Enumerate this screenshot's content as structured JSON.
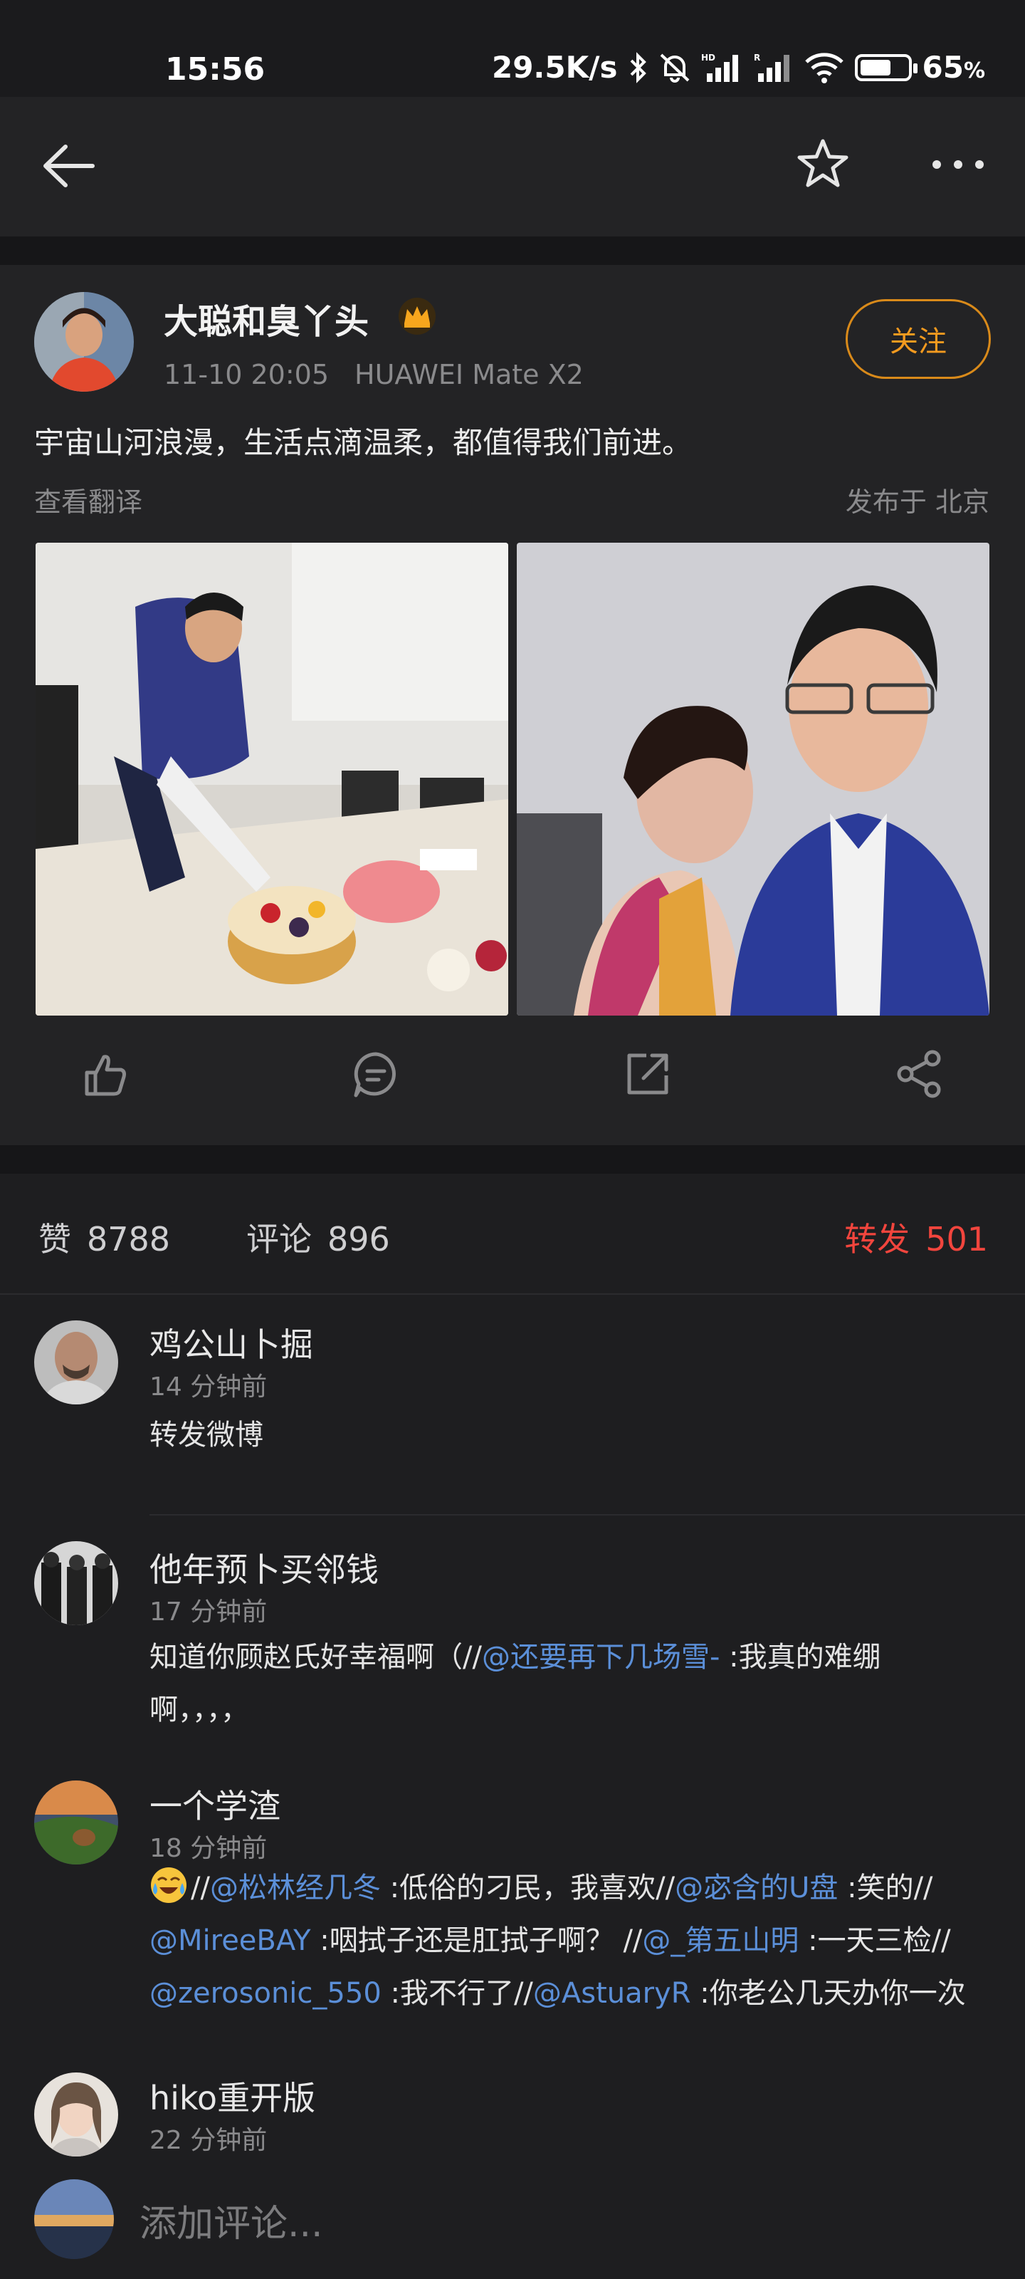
{
  "status": {
    "time": "15:56",
    "speed": "29.5K/s",
    "battery_pct": "65",
    "battery_level": 0.65,
    "icons": [
      "bluetooth-icon",
      "mute-icon",
      "signal-hd-icon",
      "signal-r-icon",
      "wifi-icon",
      "battery-icon"
    ]
  },
  "nav": {
    "icons": [
      "back-arrow-icon",
      "star-icon",
      "more-icon"
    ]
  },
  "post": {
    "author": "大聪和臭丫头",
    "date": "11-10 20:05",
    "device": "HUAWEI Mate X2",
    "follow_label": "关注",
    "text": "宇宙山河浪漫，生活点滴温柔，都值得我们前进。",
    "translate_label": "查看翻译",
    "location": "发布于 北京",
    "actions": [
      "like-icon",
      "comment-icon",
      "repost-icon",
      "share-icon"
    ]
  },
  "counts": {
    "likes_label": "赞",
    "likes": "8788",
    "comments_label": "评论",
    "comments": "896",
    "reposts_label": "转发",
    "reposts": "501"
  },
  "comments": [
    {
      "name": "鸡公山卜掘",
      "time": "14 分钟前",
      "text": "转发微博"
    },
    {
      "name": "他年预卜买邻钱",
      "time": "17 分钟前",
      "parts": [
        "知道你顾赵氏好幸福啊（//",
        "@还要再下几场雪-",
        " :我真的难绷",
        "啊，，，，"
      ]
    },
    {
      "name": "一个学渣",
      "time": "18 分钟前",
      "parts": [
        "//",
        "@松林经几冬",
        " :低俗的刁民，我喜欢//",
        "@宓含的U盘",
        " :笑的//",
        "@MireeBAY",
        " :咽拭子还是肛拭子啊？ //",
        "@_第五山明",
        " :一天三检//",
        "@zerosonic_550",
        " :我不行了//",
        "@AstuaryR",
        " :你老公几天办你一次"
      ]
    },
    {
      "name": "hiko重开版",
      "time": "22 分钟前"
    }
  ],
  "bottom": {
    "placeholder": "添加评论..."
  },
  "colors": {
    "accent_orange": "#f39a1f",
    "repost_red": "#f2453d",
    "mention_blue": "#5b8fd8"
  }
}
